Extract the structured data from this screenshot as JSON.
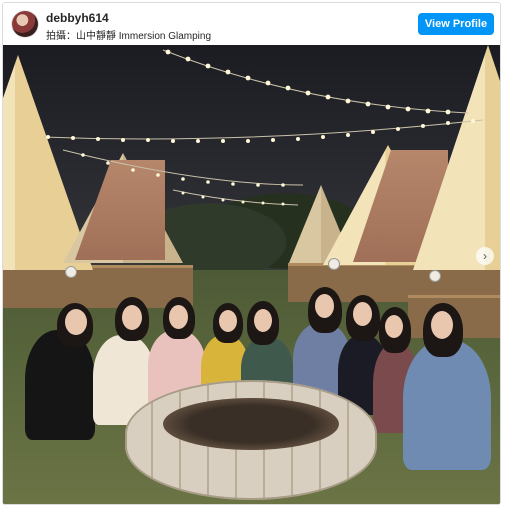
{
  "post": {
    "username": "debbyh614",
    "location": "拍攝：山中靜靜 Immersion Glamping",
    "view_profile_label": "View Profile"
  },
  "icons": {
    "avatar": "profile-avatar",
    "next": "chevron-right-icon"
  },
  "colors": {
    "button": "#0095f6",
    "text": "#262626",
    "border": "#dbdbdb"
  }
}
